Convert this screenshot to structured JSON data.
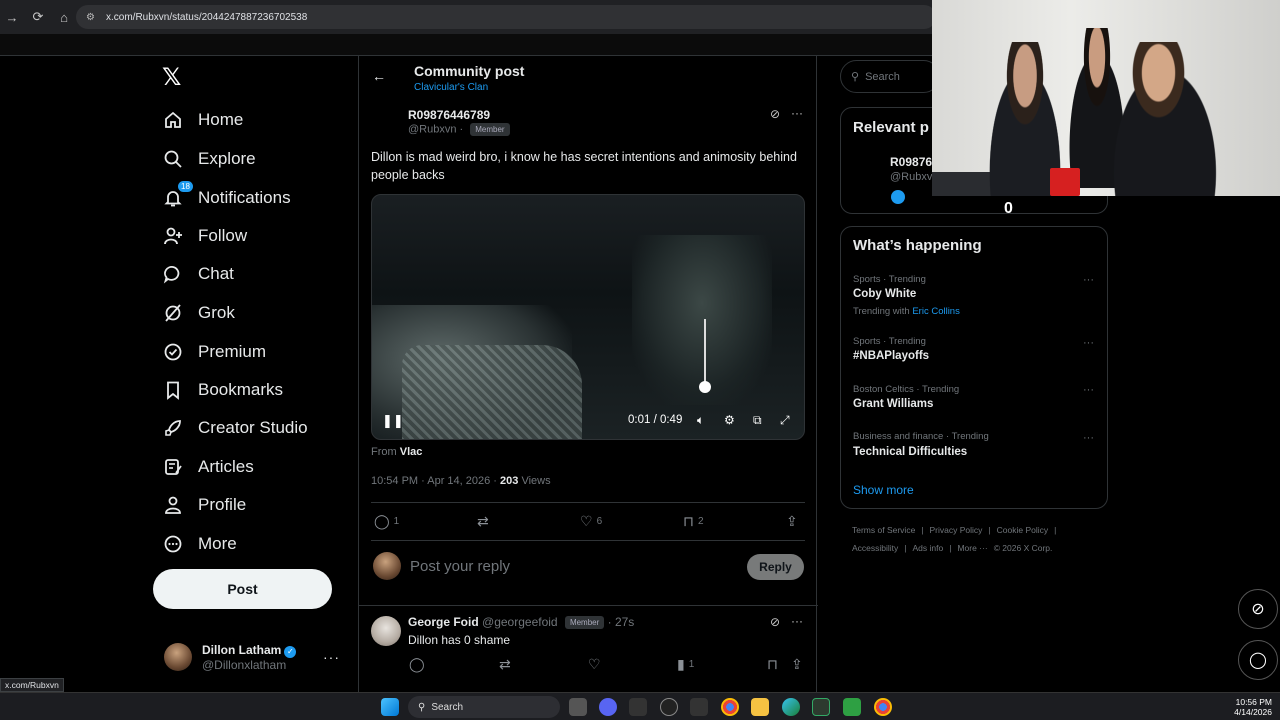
{
  "browser": {
    "url": "x.com/Rubxvn/status/2044247887236702538",
    "status_url": "x.com/Rubxvn"
  },
  "nav": {
    "items": [
      {
        "label": "Home",
        "icon": "home-icon"
      },
      {
        "label": "Explore",
        "icon": "search-icon"
      },
      {
        "label": "Notifications",
        "icon": "bell-icon",
        "badge": "18"
      },
      {
        "label": "Follow",
        "icon": "add-person-icon"
      },
      {
        "label": "Chat",
        "icon": "chat-bubble-icon"
      },
      {
        "label": "Grok",
        "icon": "grok-icon"
      },
      {
        "label": "Premium",
        "icon": "verified-badge-icon"
      },
      {
        "label": "Bookmarks",
        "icon": "bookmark-icon"
      },
      {
        "label": "Creator Studio",
        "icon": "rocket-icon"
      },
      {
        "label": "Articles",
        "icon": "article-icon"
      },
      {
        "label": "Profile",
        "icon": "person-icon"
      },
      {
        "label": "More",
        "icon": "more-circle-icon"
      }
    ],
    "post_label": "Post"
  },
  "account": {
    "name": "Dillon Latham",
    "handle": "@Dillonxlatham"
  },
  "header": {
    "title": "Community post",
    "community": "Clavicular's Clan"
  },
  "post": {
    "author_name": "R09876446789",
    "author_handle": "@Rubxvn",
    "member_label": "Member",
    "text": "Dillon is mad weird bro, i know he has secret intentions and animosity behind people backs",
    "video_time": "0:01 / 0:49",
    "video_volume_level": 0.15,
    "from_prefix": "From",
    "from_source": "Vlac",
    "meta_time": "10:54 PM · Apr 14, 2026 · ",
    "views_count": "203",
    "views_label": " Views",
    "replies": "1",
    "likes": "6",
    "bookmarks": "2"
  },
  "reply_box": {
    "placeholder": "Post your reply",
    "button": "Reply"
  },
  "reply": {
    "name": "George Foid",
    "handle": "@georgeefoid",
    "member_label": "Member",
    "time": "· 27s",
    "text": "Dillon has 0 shame",
    "views": "1"
  },
  "right": {
    "search_placeholder": "Search",
    "relevant_title": "Relevant p",
    "relevant_name": "R09876",
    "relevant_handle": "@Rubxv",
    "happening_title": "What’s happening",
    "trends": [
      {
        "category": "Sports · Trending",
        "name": "Coby White",
        "with_prefix": "Trending with ",
        "with_name": "Eric Collins"
      },
      {
        "category": "Sports · Trending",
        "name": "#NBAPlayoffs"
      },
      {
        "category": "Boston Celtics · Trending",
        "name": "Grant Williams"
      },
      {
        "category": "Business and finance · Trending",
        "name": "Technical Difficulties"
      }
    ],
    "show_more": "Show more",
    "footer_line1": [
      "Terms of Service",
      "|",
      "Privacy Policy",
      "|",
      "Cookie Policy",
      "|"
    ],
    "footer_line2": [
      "Accessibility",
      "|",
      "Ads info",
      "|",
      "More ···",
      "© 2026 X Corp."
    ]
  },
  "overlay": {
    "counter": "0"
  },
  "taskbar": {
    "search": "Search",
    "time": "10:56 PM",
    "date": "4/14/2026"
  },
  "colors": {
    "accent": "#1d9bf0",
    "background": "#000000",
    "border": "#2f3336",
    "muted": "#71767b"
  }
}
